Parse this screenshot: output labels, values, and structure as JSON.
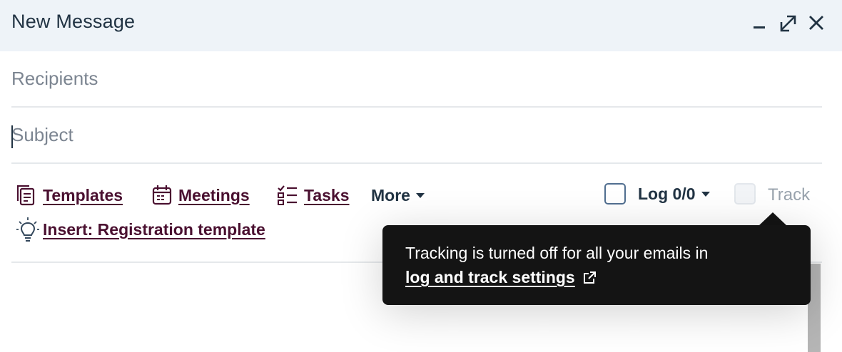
{
  "window": {
    "title": "New Message",
    "buttons": [
      {
        "name": "minimize",
        "icon": "minimize-icon"
      },
      {
        "name": "expand",
        "icon": "expand-icon"
      },
      {
        "name": "close",
        "icon": "close-icon"
      }
    ]
  },
  "fields": {
    "recipients": {
      "value": "",
      "placeholder": "Recipients"
    },
    "subject": {
      "value": "",
      "placeholder": "Subject"
    }
  },
  "toolbar": {
    "templates": {
      "label": "Templates",
      "icon": "templates-icon"
    },
    "meetings": {
      "label": "Meetings",
      "icon": "calendar-icon"
    },
    "tasks": {
      "label": "Tasks",
      "icon": "checklist-icon"
    },
    "more": {
      "label": "More",
      "icon": "caret-down-icon"
    },
    "log": {
      "label": "Log 0/0",
      "checked": false
    },
    "track": {
      "label": "Track",
      "checked": false,
      "disabled": true
    }
  },
  "suggestion": {
    "label": "Insert: Registration template",
    "icon": "lightbulb-icon"
  },
  "tooltip": {
    "text": "Tracking is turned off for all your emails in",
    "link_label": "log and track settings",
    "link_icon": "external-link-icon"
  },
  "colors": {
    "header_bg": "#eef3f8",
    "link": "#4a1030",
    "tooltip_bg": "#141414",
    "text_dark": "#213343"
  }
}
